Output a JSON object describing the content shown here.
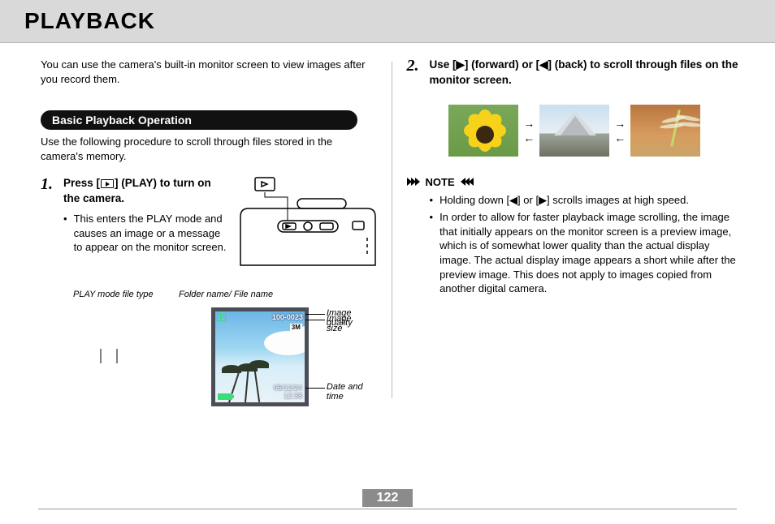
{
  "page": {
    "title": "PLAYBACK",
    "intro": "You can use the camera's built-in monitor screen to view images after you record them.",
    "page_number": "122"
  },
  "section": {
    "heading": "Basic Playback Operation",
    "desc": "Use the following procedure to scroll through files stored in the camera's memory."
  },
  "steps": [
    {
      "num": "1.",
      "title_before": "Press [",
      "title_after": "] (PLAY) to turn on the camera.",
      "bullet": "This enters the PLAY mode and causes an image or a message to appear on the monitor screen."
    },
    {
      "num": "2.",
      "title": "Use [▶] (forward) or [◀] (back) to scroll through files on the monitor screen."
    }
  ],
  "screen_labels": {
    "top1": "PLAY mode file type",
    "top2": "Folder name/ File name",
    "side1": "Image quality",
    "side2": "Image size",
    "side3": "Date and time"
  },
  "screen_data": {
    "folder_file": "100-0023",
    "size_badge": "3M",
    "quality_letter": "N",
    "date": "05/12/24",
    "time": "12:38"
  },
  "note": {
    "label": "NOTE",
    "items": [
      "Holding down [◀] or [▶] scrolls images at high speed.",
      "In order to allow for faster playback image scrolling, the image that initially appears on the monitor screen is a preview image, which is of somewhat lower quality than the actual display image. The actual display image appears a short while after the preview image. This does not apply to images copied from another digital camera."
    ]
  }
}
